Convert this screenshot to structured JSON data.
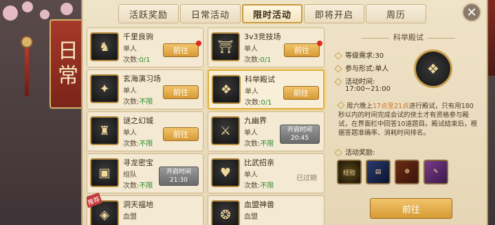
{
  "banner": {
    "chars": [
      "日",
      "常"
    ]
  },
  "tabs": [
    {
      "label": "活跃奖励",
      "active": false
    },
    {
      "label": "日常活动",
      "active": false
    },
    {
      "label": "限时活动",
      "active": true
    },
    {
      "label": "即将开启",
      "active": false
    },
    {
      "label": "周历",
      "active": false
    }
  ],
  "close": {
    "glyph": "✕"
  },
  "activities": [
    {
      "name": "千里良驹",
      "mode": "单人",
      "count_label": "次数:",
      "count": "0/1",
      "button": "前往",
      "status": "go",
      "red_dot": true,
      "icon": "horse-icon"
    },
    {
      "name": "3v3竞技场",
      "mode": "单人",
      "count_label": "次数:",
      "count": "0/1",
      "button": "前往",
      "status": "go",
      "red_dot": true,
      "icon": "arena-icon"
    },
    {
      "name": "玄海演习场",
      "mode": "单人",
      "count_label": "次数:",
      "count": "不限",
      "button": "前往",
      "status": "go",
      "red_dot": false,
      "icon": "emblem-icon"
    },
    {
      "name": "科举殿试",
      "mode": "单人",
      "count_label": "次数:",
      "count": "0/1",
      "button": "前往",
      "status": "go",
      "red_dot": false,
      "selected": true,
      "icon": "scroll-icon"
    },
    {
      "name": "谜之幻城",
      "mode": "单人",
      "count_label": "次数:",
      "count": "不限",
      "button": "前往",
      "status": "go",
      "red_dot": false,
      "icon": "castle-icon"
    },
    {
      "name": "九幽界",
      "mode": "单人",
      "count_label": "次数:",
      "count": "不限",
      "button": "开启时间",
      "time": "20:45",
      "status": "time",
      "icon": "sword-icon"
    },
    {
      "name": "寻龙密宝",
      "mode": "组队",
      "count_label": "次数:",
      "count": "不限",
      "button": "开启时间",
      "time": "21:30",
      "status": "time",
      "icon": "chest-icon"
    },
    {
      "name": "比武招亲",
      "mode": "单人",
      "count_label": "次数:",
      "count": "不限",
      "button": "已过期",
      "status": "expired",
      "icon": "heart-icon"
    },
    {
      "name": "洞天福地",
      "mode": "血盟",
      "count_label": "",
      "count": "",
      "button": "",
      "status": "partial",
      "badge": "推荐",
      "icon": "cave-icon"
    },
    {
      "name": "血盟神兽",
      "mode": "血盟",
      "count_label": "",
      "count": "",
      "button": "",
      "status": "partial",
      "icon": "beast-icon"
    }
  ],
  "detail": {
    "title": "科举殿试",
    "level_label": "等级需求:",
    "level_value": "30",
    "mode_label": "参与形式:",
    "mode_value": "单人",
    "time_label": "活动时间:",
    "time_value": "17:00~21:00",
    "desc_prefix": "周六晚上",
    "desc_hl": "17点至21点",
    "desc_suffix": "进行殿试，只有用180秒以内的时间完成会试的侠士才有资格参与殿试，在界面栏中回答10道题目。殿试结束后，根据答题准确率、消耗时间排名。",
    "reward_label": "活动奖励:",
    "rewards": [
      {
        "label": "经验",
        "icon": "exp-icon"
      },
      {
        "label": "",
        "icon": "book-icon"
      },
      {
        "label": "",
        "icon": "scroll-red-icon"
      },
      {
        "label": "",
        "icon": "scroll-purple-icon"
      }
    ],
    "go_label": "前往"
  }
}
